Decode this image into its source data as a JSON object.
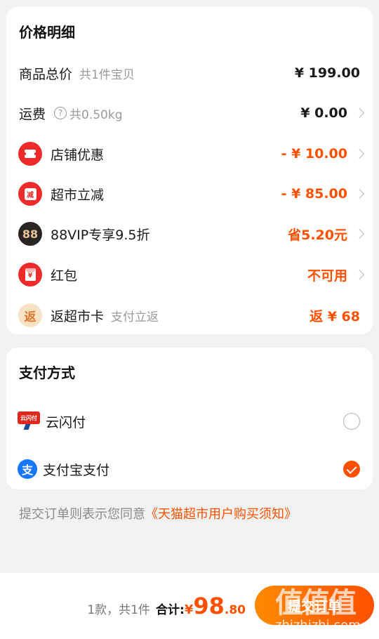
{
  "price_detail": {
    "title": "价格明细",
    "goods_total": {
      "label": "商品总价",
      "sub": "共1件宝贝",
      "value": "¥ 199.00"
    },
    "shipping": {
      "label": "运费",
      "sub": "共0.50kg",
      "value": "¥ 0.00"
    },
    "shop_discount": {
      "icon": "coupon-ticket-icon",
      "label": "店铺优惠",
      "value": "- ¥ 10.00"
    },
    "market_discount": {
      "icon": "reduction-icon",
      "icon_text": "减",
      "label": "超市立减",
      "value": "- ¥ 85.00"
    },
    "vip": {
      "icon": "88vip-icon",
      "icon_text": "88",
      "label": "88VIP专享9.5折",
      "value": "省5.20元"
    },
    "red_packet": {
      "icon": "red-packet-icon",
      "icon_text": "¥",
      "label": "红包",
      "value": "不可用"
    },
    "rebate_card": {
      "icon": "rebate-icon",
      "icon_text": "返",
      "label": "返超市卡",
      "sub": "支付立返",
      "value": "返 ¥ 68"
    }
  },
  "payment": {
    "title": "支付方式",
    "methods": [
      {
        "name": "云闪付",
        "logo_text": "云闪付",
        "selected": false
      },
      {
        "name": "支付宝支付",
        "logo_text": "支",
        "selected": true
      }
    ]
  },
  "agreement": {
    "prefix": "提交订单则表示您同意",
    "link": "《天猫超市用户购买须知》"
  },
  "bottom": {
    "count": "1款，共1件",
    "total_label": "合计:",
    "currency": "¥",
    "amount_int": "98",
    "amount_dec": ".80",
    "submit_label": "提交订单"
  },
  "watermark": {
    "text": "值值值",
    "url": "zhizhizhi.com"
  },
  "colors": {
    "accent": "#ff5000",
    "background": "#f2f2f2",
    "alipay_blue": "#1677ff",
    "red_icon": "#ee2a2a"
  }
}
